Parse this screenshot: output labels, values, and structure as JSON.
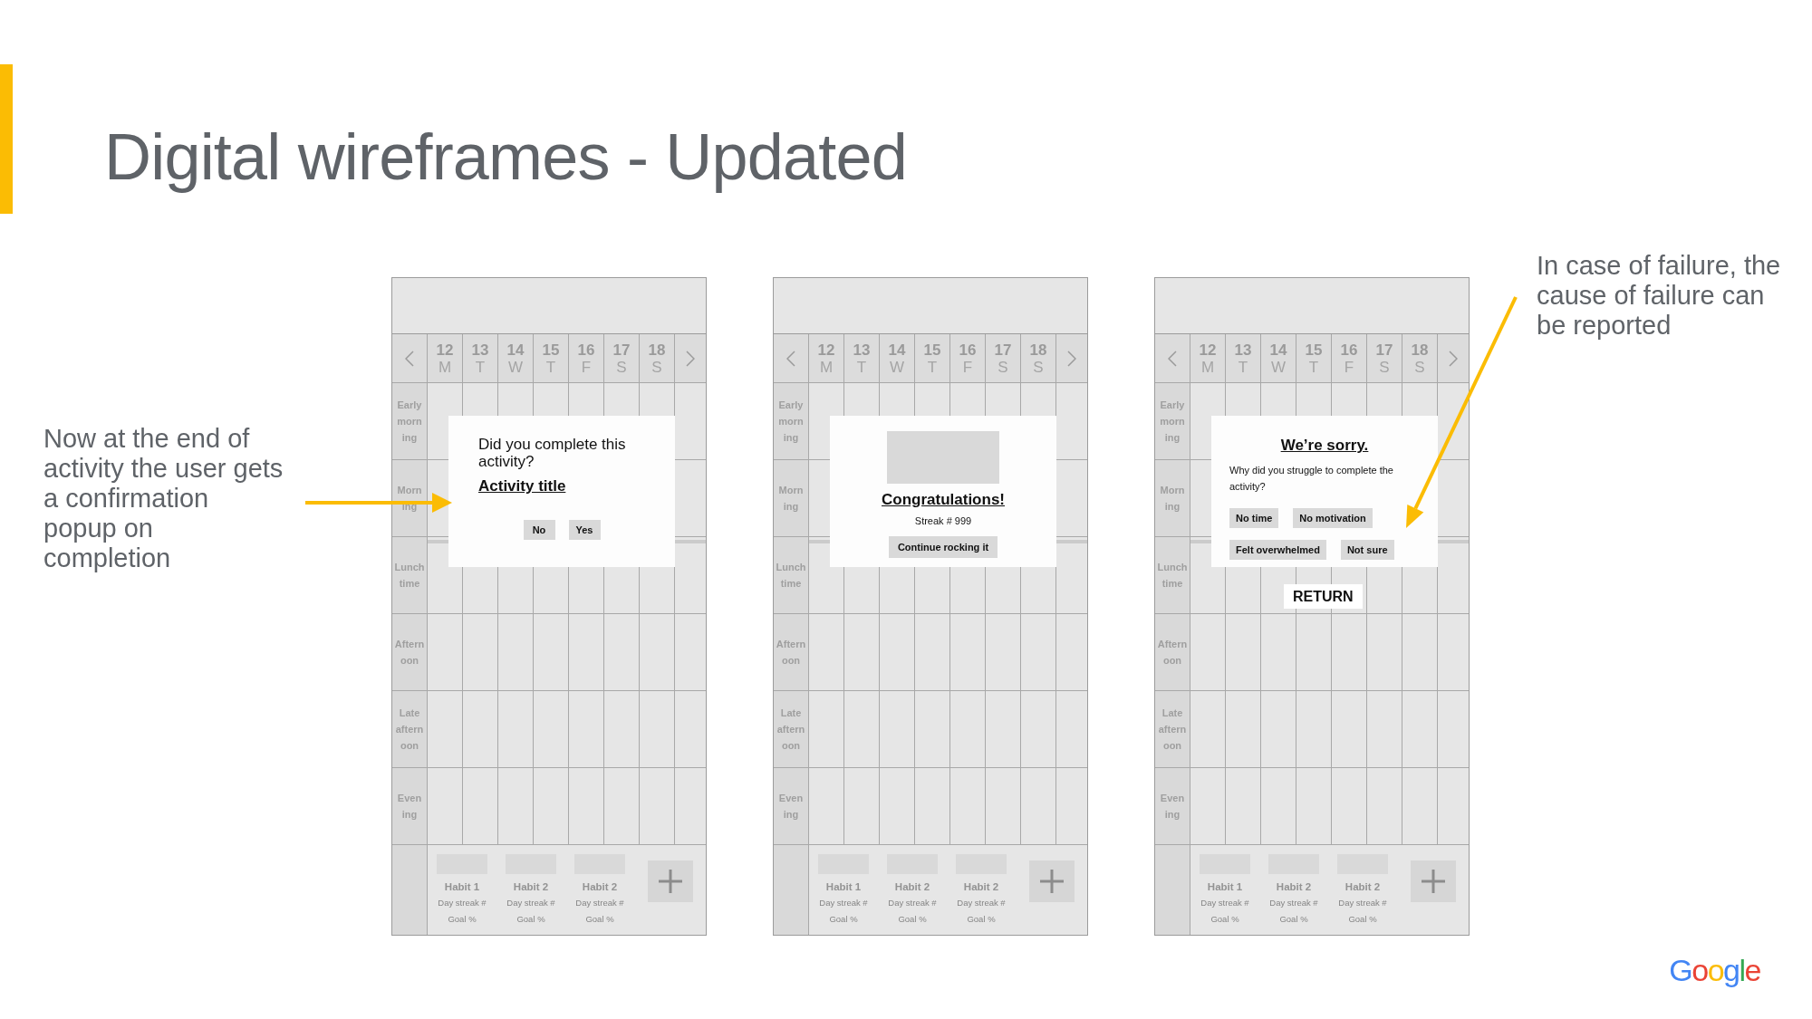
{
  "slide": {
    "title": "Digital wireframes - Updated"
  },
  "left_note": "Now at the end of activity the user gets a confirmation popup on completion",
  "phones": [
    {
      "days": [
        {
          "date": "12",
          "weekday": "M"
        },
        {
          "date": "13",
          "weekday": "T"
        },
        {
          "date": "14",
          "weekday": "W"
        },
        {
          "date": "15",
          "weekday": "T"
        },
        {
          "date": "16",
          "weekday": "F"
        },
        {
          "date": "17",
          "weekday": "S"
        },
        {
          "date": "18",
          "weekday": "S"
        }
      ],
      "time_slots": [
        "Early morn ing",
        "Morn ing",
        "Lunch time",
        "Aftern oon",
        "Late aftern oon",
        "Even ing"
      ],
      "habits": [
        {
          "name": "Habit 1",
          "streak": "Day streak #",
          "goal": "Goal %"
        },
        {
          "name": "Habit 2",
          "streak": "Day streak #",
          "goal": "Goal %"
        },
        {
          "name": "Habit 2",
          "streak": "Day streak #",
          "goal": "Goal %"
        }
      ],
      "popup": {
        "kind": "confirm",
        "question": "Did you complete this activity?",
        "activity_title": "Activity title",
        "buttons": [
          "No",
          "Yes"
        ]
      }
    },
    {
      "days": [
        {
          "date": "12",
          "weekday": "M"
        },
        {
          "date": "13",
          "weekday": "T"
        },
        {
          "date": "14",
          "weekday": "W"
        },
        {
          "date": "15",
          "weekday": "T"
        },
        {
          "date": "16",
          "weekday": "F"
        },
        {
          "date": "17",
          "weekday": "S"
        },
        {
          "date": "18",
          "weekday": "S"
        }
      ],
      "time_slots": [
        "Early morn ing",
        "Morn ing",
        "Lunch time",
        "Aftern oon",
        "Late aftern oon",
        "Even ing"
      ],
      "habits": [
        {
          "name": "Habit 1",
          "streak": "Day streak #",
          "goal": "Goal %"
        },
        {
          "name": "Habit 2",
          "streak": "Day streak #",
          "goal": "Goal %"
        },
        {
          "name": "Habit 2",
          "streak": "Day streak #",
          "goal": "Goal %"
        }
      ],
      "popup": {
        "kind": "congrats",
        "heading": "Congratulations!",
        "streak": "Streak # 999",
        "button": "Continue rocking it"
      }
    },
    {
      "days": [
        {
          "date": "12",
          "weekday": "M"
        },
        {
          "date": "13",
          "weekday": "T"
        },
        {
          "date": "14",
          "weekday": "W"
        },
        {
          "date": "15",
          "weekday": "T"
        },
        {
          "date": "16",
          "weekday": "F"
        },
        {
          "date": "17",
          "weekday": "S"
        },
        {
          "date": "18",
          "weekday": "S"
        }
      ],
      "time_slots": [
        "Early morn ing",
        "Morn ing",
        "Lunch time",
        "Aftern oon",
        "Late aftern oon",
        "Even ing"
      ],
      "habits": [
        {
          "name": "Habit 1",
          "streak": "Day streak #",
          "goal": "Goal %"
        },
        {
          "name": "Habit 2",
          "streak": "Day streak #",
          "goal": "Goal %"
        },
        {
          "name": "Habit 2",
          "streak": "Day streak #",
          "goal": "Goal %"
        }
      ],
      "popup": {
        "kind": "reason",
        "heading": "We’re sorry.",
        "question": "Why did you struggle to complete the activity?",
        "options": [
          "No time",
          "No motivation",
          "Felt overwhelmed",
          "Not sure"
        ],
        "return_button": "RETURN"
      }
    }
  ],
  "right_note": "In case of failure, the cause of failure can be reported",
  "logo": "Google"
}
